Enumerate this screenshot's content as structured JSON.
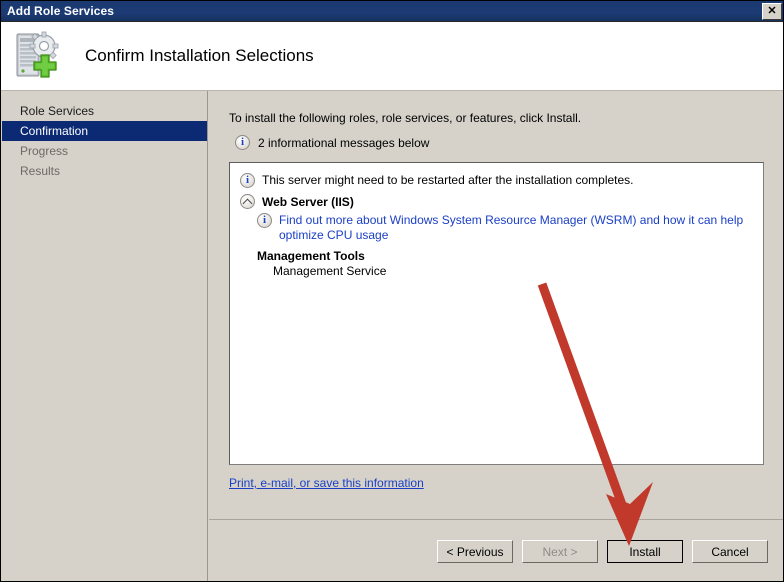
{
  "window": {
    "title": "Add Role Services",
    "close_label": "✕",
    "header_title": "Confirm Installation Selections",
    "header_icon": "server-add-icon"
  },
  "sidebar": {
    "items": [
      {
        "label": "Role Services",
        "state": "normal"
      },
      {
        "label": "Confirmation",
        "state": "active"
      },
      {
        "label": "Progress",
        "state": "dim"
      },
      {
        "label": "Results",
        "state": "dim"
      }
    ]
  },
  "content": {
    "intro": "To install the following roles, role services, or features, click Install.",
    "info_icon": "info-icon",
    "info_message": "2 informational messages below",
    "details": {
      "restart_icon": "info-icon",
      "restart_message": "This server might need to be restarted after the installation completes.",
      "collapse_icon": "chevron-up-icon",
      "role_label": "Web Server (IIS)",
      "wsrm_icon": "info-icon",
      "wsrm_link": "Find out more about Windows System Resource Manager (WSRM) and how it can help optimize CPU usage",
      "group_title": "Management Tools",
      "group_child": "Management Service"
    },
    "print_link": "Print, e-mail, or save this information"
  },
  "footer": {
    "previous_label": "< Previous",
    "next_label": "Next >",
    "install_label": "Install",
    "cancel_label": "Cancel"
  },
  "annotation": {
    "arrow_color": "#c0392b",
    "points_to": "install-button"
  },
  "colors": {
    "titlebar": "#1b3a71",
    "selection": "#0b2a73",
    "link": "#1a3fc4",
    "dialog_face": "#d6d2ca",
    "arrow": "#c0392b"
  }
}
